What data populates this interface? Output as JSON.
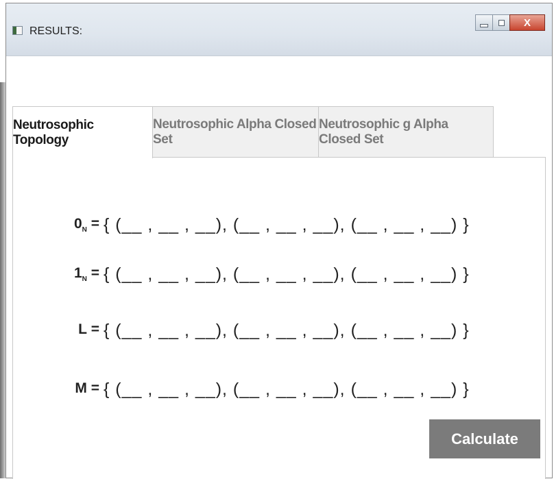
{
  "window": {
    "title": "RESULTS:"
  },
  "controls": {
    "minimize": "",
    "maximize": "",
    "close": "X"
  },
  "tabs": [
    {
      "label": "Neutrosophic Topology",
      "active": true
    },
    {
      "label": "Neutrosophic Alpha Closed Set",
      "active": false
    },
    {
      "label": "Neutrosophic g Alpha Closed Set",
      "active": false
    }
  ],
  "rows": [
    {
      "label_main": "0",
      "label_sub": "N",
      "label_eq": "=",
      "set": "{ (__ , __ , __), (__ , __ , __), (__ , __ , __) }"
    },
    {
      "label_main": "1",
      "label_sub": "N",
      "label_eq": "=",
      "set": "{ (__ , __ , __), (__ , __ , __), (__ , __ , __) }"
    },
    {
      "label_main": "L",
      "label_sub": "",
      "label_eq": "=",
      "set": "{ (__ , __ , __), (__ , __ , __), (__ , __ , __) }"
    },
    {
      "label_main": "M",
      "label_sub": "",
      "label_eq": "=",
      "set": "{ (__ , __ , __), (__ , __ , __), (__ , __ , __) }"
    }
  ],
  "actions": {
    "calculate": "Calculate"
  },
  "colors": {
    "button": "#7b7b7b",
    "close": "#c8452f"
  }
}
